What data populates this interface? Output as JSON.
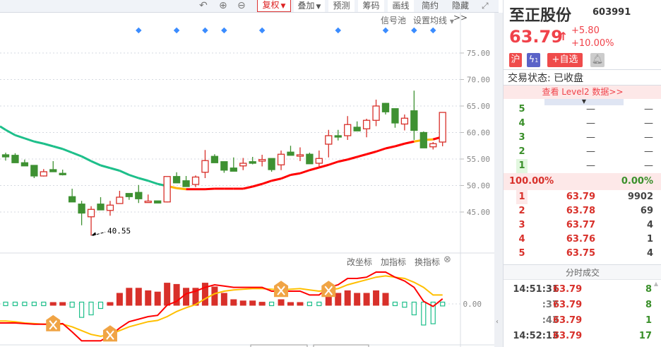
{
  "toolbar": {
    "fuquan": "复权",
    "diejia": "叠加",
    "yuce": "预测",
    "chouma": "筹码",
    "huaxian": "画线",
    "jianyue": "简约",
    "yincang": "隐藏>>"
  },
  "chart_links": {
    "signal_pool": "信号池",
    "set_ma": "设置均线"
  },
  "indicator_links": {
    "change_axis": "改坐标",
    "add_indicator": "加指标",
    "switch_indicator": "换指标"
  },
  "colors": {
    "up": "#d8302a",
    "down": "#3e9132",
    "ma_down": "#1dbf8a",
    "ma_up": "#ff0000",
    "ma_flat": "#ffb400",
    "dea": "#ffbf00",
    "signal": "#3b8cff",
    "cross": "#f0a445"
  },
  "chart_data": [
    {
      "type": "candlestick",
      "yticks": [
        75,
        70,
        65,
        60,
        55,
        50,
        45
      ],
      "ytick_labels": [
        "75.00",
        "70.00",
        "65.00",
        "60.00",
        "55.00",
        "50.00",
        "45.00"
      ],
      "ylim": [
        40,
        77
      ],
      "annotation": {
        "index": 9,
        "value": 40.55,
        "label": "40.55"
      },
      "ohlc": [
        [
          55.8,
          56.2,
          54.7,
          55.4
        ],
        [
          55.7,
          56.1,
          54.3,
          54.3
        ],
        [
          54.3,
          54.9,
          53.7,
          53.7
        ],
        [
          53.8,
          53.8,
          51.4,
          51.8
        ],
        [
          51.8,
          53.1,
          51.7,
          52.6
        ],
        [
          53.0,
          54.6,
          52.6,
          52.6
        ],
        [
          52.3,
          53.0,
          51.9,
          52.1
        ],
        [
          47.9,
          49.4,
          46.9,
          46.9
        ],
        [
          46.5,
          47.1,
          42.5,
          44.8
        ],
        [
          44.1,
          46.1,
          40.55,
          45.5
        ],
        [
          46.5,
          47.8,
          45.4,
          45.4
        ],
        [
          45.3,
          47.1,
          44.3,
          46.3
        ],
        [
          46.6,
          49.0,
          46.6,
          47.8
        ],
        [
          48.5,
          48.5,
          47.3,
          47.9
        ],
        [
          48.7,
          50.1,
          46.7,
          47.5
        ],
        [
          47.0,
          48.3,
          47.0,
          47.05
        ],
        [
          47.1,
          47.1,
          46.7,
          46.7
        ],
        [
          46.9,
          51.7,
          46.8,
          51.7
        ],
        [
          51.7,
          52.5,
          50.5,
          50.5
        ],
        [
          50.9,
          51.8,
          49.8,
          49.8
        ],
        [
          50.2,
          51.9,
          49.7,
          51.6
        ],
        [
          52.5,
          56.7,
          51.4,
          54.7
        ],
        [
          55.5,
          55.9,
          54.3,
          54.3
        ],
        [
          54.5,
          54.5,
          52.4,
          52.9
        ],
        [
          53.3,
          55.3,
          52.7,
          52.7
        ],
        [
          53.7,
          55.2,
          52.9,
          54.2
        ],
        [
          54.5,
          55.4,
          54.0,
          54.2
        ],
        [
          54.6,
          55.8,
          53.6,
          54.9
        ],
        [
          55.1,
          55.1,
          52.6,
          53.0
        ],
        [
          53.9,
          56.6,
          52.9,
          55.9
        ],
        [
          56.3,
          57.5,
          55.7,
          55.7
        ],
        [
          55.7,
          57.2,
          54.6,
          55.8
        ],
        [
          55.9,
          56.2,
          54.1,
          54.1
        ],
        [
          54.2,
          56.6,
          53.6,
          55.1
        ],
        [
          57.8,
          60.5,
          55.3,
          59.4
        ],
        [
          59.4,
          60.5,
          58.5,
          59.3
        ],
        [
          59.4,
          63.1,
          58.6,
          61.5
        ],
        [
          61.0,
          62.1,
          60.3,
          60.3
        ],
        [
          60.7,
          62.6,
          59.1,
          62.3
        ],
        [
          62.3,
          66.2,
          61.2,
          65.0
        ],
        [
          65.5,
          65.6,
          63.4,
          63.9
        ],
        [
          64.5,
          64.5,
          60.9,
          61.8
        ],
        [
          61.6,
          63.4,
          60.4,
          62.7
        ],
        [
          64.1,
          67.9,
          58.6,
          60.4
        ],
        [
          60.0,
          60.2,
          57.1,
          57.1
        ],
        [
          57.3,
          58.2,
          56.8,
          57.9
        ],
        [
          58.2,
          63.79,
          57.4,
          63.79
        ]
      ],
      "ma": [
        60.5,
        59.5,
        58.9,
        58.3,
        57.9,
        57.4,
        56.9,
        56.2,
        55.5,
        54.6,
        53.8,
        53.3,
        52.8,
        52.0,
        51.4,
        50.9,
        50.3,
        49.9,
        49.5,
        49.3,
        49.3,
        49.3,
        49.4,
        49.4,
        49.4,
        49.4,
        49.8,
        50.3,
        50.9,
        51.3,
        52.0,
        52.3,
        52.9,
        53.4,
        53.9,
        54.5,
        54.9,
        55.4,
        55.9,
        56.4,
        57.0,
        57.4,
        57.9,
        58.3,
        58.6,
        58.7,
        59.2
      ],
      "signals": [
        14,
        18,
        21,
        23,
        27,
        35,
        40,
        43,
        45
      ]
    },
    {
      "type": "macd",
      "ytick_labels": [
        "0.00"
      ],
      "hist": [
        -1,
        -1,
        -1,
        -2,
        -1,
        2,
        2,
        -4,
        -12,
        -10,
        -5,
        2,
        10,
        14,
        14,
        12,
        11,
        18,
        17,
        14,
        14,
        18,
        15,
        10,
        5,
        4,
        4,
        3,
        -1,
        5,
        2,
        2,
        -1,
        -1,
        7,
        10,
        12,
        10,
        10,
        12,
        10,
        -1,
        -4,
        -10,
        -18,
        -17,
        -3
      ],
      "dif": [
        -15,
        -15,
        -15.5,
        -16,
        -16,
        -16,
        -15.5,
        -22,
        -29,
        -29,
        -29,
        -25,
        -19,
        -14,
        -12,
        -10,
        -9,
        -1,
        2,
        8,
        10,
        13,
        15,
        14,
        13,
        13,
        13,
        13,
        10,
        10,
        10,
        10,
        7,
        7,
        13,
        15,
        20,
        20,
        21,
        25,
        25,
        21,
        18,
        13,
        2,
        -2,
        4
      ],
      "dea": [
        -13.5,
        -14,
        -15,
        -15.5,
        -16,
        -16,
        -16,
        -18,
        -21,
        -24,
        -25.5,
        -24,
        -21,
        -18,
        -16,
        -14,
        -13,
        -10,
        -6,
        -3,
        -0.5,
        4,
        8,
        10,
        11,
        11.5,
        12,
        12,
        11.5,
        11,
        11.5,
        12,
        11,
        10,
        11,
        12,
        15,
        17,
        19,
        21,
        22,
        21,
        20,
        17,
        13,
        7,
        7
      ],
      "crosses": [
        {
          "index": 5,
          "at": "dea"
        },
        {
          "index": 11,
          "at": "dea"
        },
        {
          "index": 29,
          "at": "dea"
        },
        {
          "index": 34,
          "at": "dea"
        }
      ]
    }
  ],
  "stock": {
    "name": "至正股份",
    "code": "603991",
    "price": "63.79",
    "change": "+5.80",
    "change_pct": "+10.00%",
    "market_badge": "沪",
    "flash_badge_count": "1",
    "watchlist_label": "+自选",
    "trade_status": "交易状态: 已收盘",
    "level2_link": "查看 Level2 数据>>"
  },
  "order_book": {
    "sell": [
      {
        "level": "5",
        "price": "—",
        "volume": "—"
      },
      {
        "level": "4",
        "price": "—",
        "volume": "—"
      },
      {
        "level": "3",
        "price": "—",
        "volume": "—"
      },
      {
        "level": "2",
        "price": "—",
        "volume": "—"
      },
      {
        "level": "1",
        "price": "—",
        "volume": "—"
      }
    ],
    "ratio_buy": "100.00%",
    "ratio_sell": "0.00%",
    "buy": [
      {
        "level": "1",
        "price": "63.79",
        "volume": "9902"
      },
      {
        "level": "2",
        "price": "63.78",
        "volume": "69"
      },
      {
        "level": "3",
        "price": "63.77",
        "volume": "4"
      },
      {
        "level": "4",
        "price": "63.76",
        "volume": "1"
      },
      {
        "level": "5",
        "price": "63.75",
        "volume": "4"
      }
    ]
  },
  "trades": {
    "title": "分时成交",
    "rows": [
      {
        "time": "14:51:31",
        "price": "63.79",
        "volume": "8"
      },
      {
        "time": ":37",
        "price": "63.79",
        "volume": "8"
      },
      {
        "time": ":43",
        "price": "63.79",
        "volume": "1"
      },
      {
        "time": "14:52:13",
        "price": "63.79",
        "volume": "17"
      }
    ]
  }
}
